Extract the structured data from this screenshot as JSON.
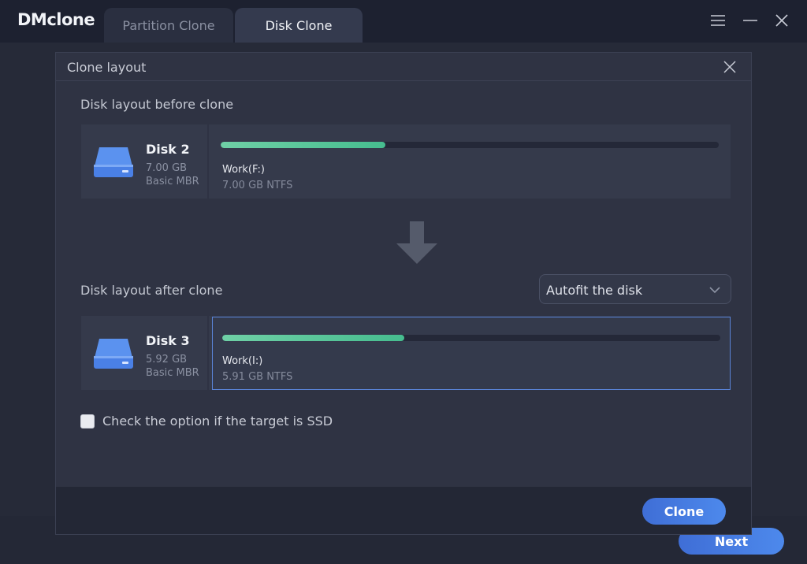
{
  "app": {
    "title": "DMclone"
  },
  "tabs": [
    {
      "label": "Partition Clone",
      "active": false
    },
    {
      "label": "Disk Clone",
      "active": true
    }
  ],
  "window_controls": {
    "icons": [
      "menu-icon",
      "minimize-icon",
      "close-icon"
    ]
  },
  "background": {
    "next_label": "Next"
  },
  "dialog": {
    "title": "Clone layout",
    "before_label": "Disk layout before clone",
    "after_label": "Disk layout after clone",
    "source_disk": {
      "name": "Disk 2",
      "size": "7.00 GB",
      "type": "Basic MBR",
      "partition": {
        "name": "Work(F:)",
        "detail": "7.00 GB NTFS",
        "used_fraction": 0.33
      }
    },
    "target_disk": {
      "name": "Disk 3",
      "size": "5.92 GB",
      "type": "Basic MBR",
      "partition": {
        "name": "Work(I:)",
        "detail": "5.91 GB NTFS",
        "used_fraction": 0.365
      }
    },
    "layout_option": {
      "selected": "Autofit the disk"
    },
    "ssd_option": {
      "label": "Check the option if the target is SSD",
      "checked": false
    },
    "clone_label": "Clone"
  },
  "colors": {
    "accent": "#4a80e6",
    "bar": "#56c599",
    "disk_icon": "#4f86e4"
  }
}
